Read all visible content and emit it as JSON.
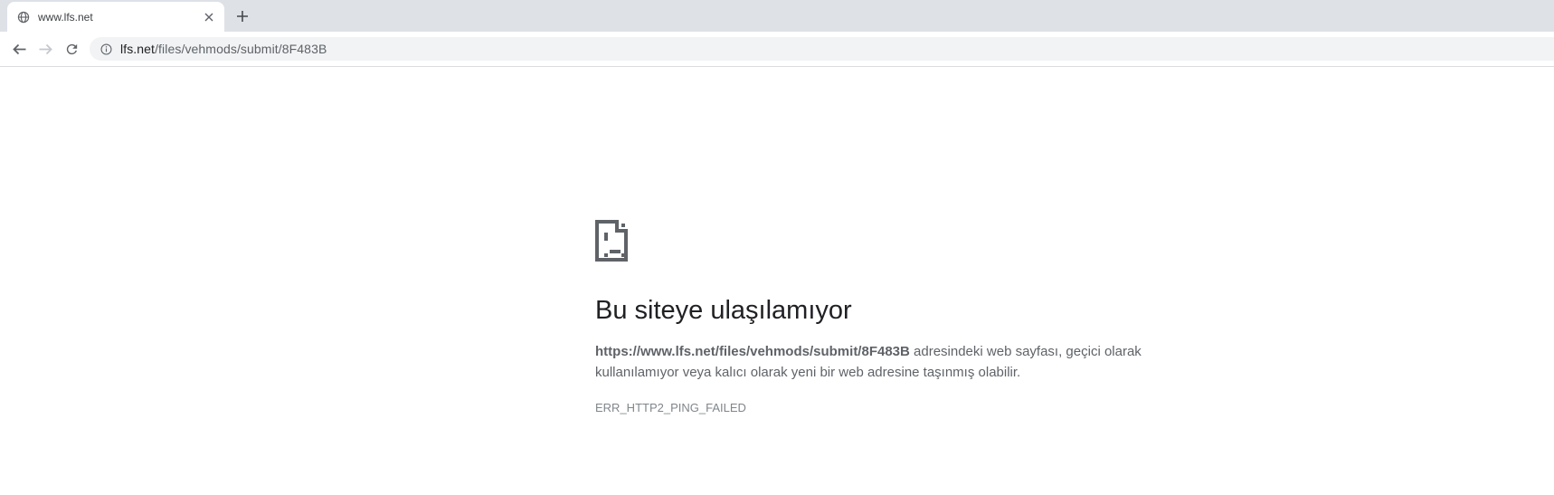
{
  "tab": {
    "title": "www.lfs.net",
    "favicon": "globe-icon"
  },
  "tabbar": {
    "new_tab_icon": "plus-icon",
    "close_tab_icon": "x-icon"
  },
  "toolbar": {
    "back_icon": "arrow-left-icon",
    "forward_icon": "arrow-right-icon",
    "reload_icon": "reload-icon",
    "info_icon": "info-circle-icon"
  },
  "address_bar": {
    "domain": "lfs.net",
    "path": "/files/vehmods/submit/8F483B",
    "full_display": "lfs.net/files/vehmods/submit/8F483B"
  },
  "error_page": {
    "icon": "sad-file-icon",
    "title": "Bu siteye ulaşılamıyor",
    "url_bold": "https://www.lfs.net/files/vehmods/submit/8F483B",
    "description": " adresindeki web sayfası, geçici olarak kullanılamıyor veya kalıcı olarak yeni bir web adresine taşınmış olabilir.",
    "error_code": "ERR_HTTP2_PING_FAILED"
  },
  "colors": {
    "tabstrip_bg": "#dee1e6",
    "toolbar_bg": "#ffffff",
    "omnibox_bg": "#f1f3f4",
    "separator": "#dadce0",
    "icon_gray": "#5f6368",
    "disabled_icon": "#c5c8cc",
    "title_text": "#202124",
    "body_text": "#5f6368",
    "error_code_text": "#80868b"
  }
}
